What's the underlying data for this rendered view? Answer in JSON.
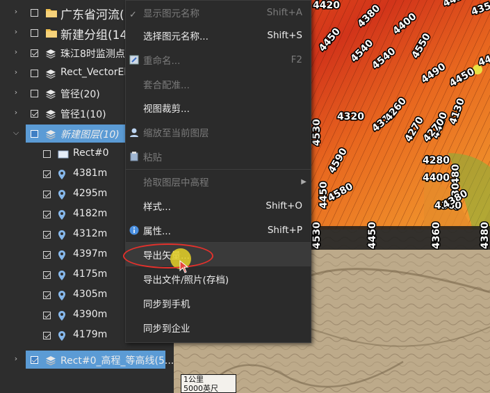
{
  "tree": {
    "items": [
      {
        "label": "广东省河流(",
        "type": "folder",
        "checked": false,
        "expander": "collapsed",
        "big": true
      },
      {
        "label": "新建分组(14",
        "type": "folder",
        "checked": false,
        "expander": "collapsed",
        "big": true
      },
      {
        "label": "珠江8时监测点位",
        "type": "layer",
        "checked": true,
        "expander": "collapsed"
      },
      {
        "label": "Rect_VectorElem",
        "type": "layer",
        "checked": false,
        "expander": "collapsed"
      },
      {
        "label": "管径(20)",
        "type": "layer",
        "checked": false,
        "expander": "collapsed"
      },
      {
        "label": "管径1(10)",
        "type": "layer",
        "checked": true,
        "expander": "collapsed"
      },
      {
        "label": "新建图层(10)",
        "type": "layer",
        "checked": false,
        "expander": "expanded",
        "selected": true
      },
      {
        "label": "Rect#0",
        "type": "rect",
        "checked": false
      },
      {
        "label": "4381m",
        "type": "pin",
        "checked": true
      },
      {
        "label": "4295m",
        "type": "pin",
        "checked": true
      },
      {
        "label": "4182m",
        "type": "pin",
        "checked": true
      },
      {
        "label": "4312m",
        "type": "pin",
        "checked": true
      },
      {
        "label": "4397m",
        "type": "pin",
        "checked": true
      },
      {
        "label": "4175m",
        "type": "pin",
        "checked": true
      },
      {
        "label": "4305m",
        "type": "pin",
        "checked": true
      },
      {
        "label": "4390m",
        "type": "pin",
        "checked": true
      },
      {
        "label": "4179m",
        "type": "pin",
        "checked": true
      },
      {
        "label": "Rect#0_高程_等高线(5...",
        "type": "layer",
        "checked": true,
        "expander": "collapsed",
        "selected": true
      }
    ]
  },
  "menu": {
    "items": [
      {
        "label": "显示图元名称",
        "shortcut": "Shift+A",
        "enabled": false,
        "icon": "check-icon"
      },
      {
        "label": "选择图元名称...",
        "shortcut": "Shift+S",
        "enabled": true
      },
      {
        "label": "重命名...",
        "shortcut": "F2",
        "enabled": false,
        "icon": "rename-icon"
      },
      {
        "label": "套合配准...",
        "shortcut": "",
        "enabled": false
      },
      {
        "label": "视图裁剪...",
        "shortcut": "",
        "enabled": true
      },
      {
        "label": "缩放至当前图层",
        "shortcut": "",
        "enabled": false,
        "icon": "zoom-layer-icon"
      },
      {
        "label": "粘贴",
        "shortcut": "",
        "enabled": false,
        "icon": "paste-icon"
      },
      {
        "label": "拾取图层中高程",
        "shortcut": "",
        "enabled": false,
        "submenu": true
      },
      {
        "label": "样式...",
        "shortcut": "Shift+O",
        "enabled": true
      },
      {
        "label": "属性...",
        "shortcut": "Shift+P",
        "enabled": true,
        "icon": "info-icon"
      },
      {
        "label": "导出矢量...",
        "shortcut": "",
        "enabled": true,
        "hover": true
      },
      {
        "label": "导出文件/照片(存档)",
        "shortcut": "",
        "enabled": true
      },
      {
        "label": "同步到手机",
        "shortcut": "",
        "enabled": true
      },
      {
        "label": "同步到企业",
        "shortcut": "",
        "enabled": true
      }
    ]
  },
  "map": {
    "contour_labels": [
      "4420",
      "4450",
      "4350",
      "4380",
      "4400",
      "4450",
      "4540",
      "4550",
      "4540",
      "4400",
      "4490",
      "4450",
      "4490",
      "4320",
      "4310",
      "4260",
      "4270",
      "4420",
      "4280",
      "4400",
      "4580",
      "4590",
      "4530",
      "4480",
      "4530",
      "4450",
      "4360",
      "4380",
      "4130",
      "4270"
    ],
    "scale": {
      "distance": "1公里",
      "ratio": "5000英尺"
    }
  }
}
